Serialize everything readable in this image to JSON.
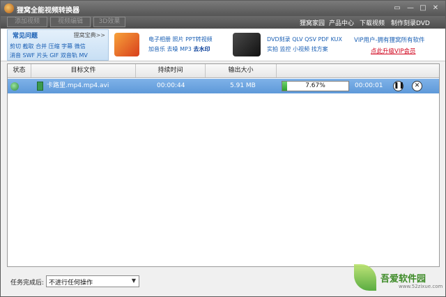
{
  "window": {
    "title": "狸窝全能视频转换器",
    "controls": {
      "restore": "▭",
      "minimize": "—",
      "maximize": "□",
      "close": "✕"
    }
  },
  "toolbar": {
    "buttons": [
      "添加视频",
      "视频编辑",
      "3D效果"
    ],
    "nav": [
      "狸窝家园",
      "产品中心",
      "下载视频",
      "制作刻录DVD"
    ]
  },
  "banner": {
    "faq": {
      "title": "常见问题",
      "link": "狸窝宝典>>",
      "line1": "剪切 截取 合并 压缩 字幕 微信",
      "line2": "消音 SWF 片头 GIF 双音轨 MV"
    },
    "promo1": {
      "line1": "电子相册 照片 PPT转视频",
      "line2_plain": "加音乐 去噪 MP3",
      "line2_bold": "去水印"
    },
    "promo2": {
      "line1": "DVD刻录 QLV QSV PDF KUX",
      "line2": "实拍 监控 小视频 找方案"
    },
    "vip": {
      "title": "VIP用户-拥有狸窝所有软件",
      "link": "点此升级VIP会员"
    }
  },
  "table": {
    "headers": [
      "状态",
      "目标文件",
      "持续时间",
      "输出大小",
      ""
    ],
    "rows": [
      {
        "file": "卡路里.mp4.mp4.avi",
        "duration": "00:00:44",
        "size": "5.91 MB",
        "progress_label": "7.67%",
        "progress": 0.0767,
        "elapsed": "00:00:01",
        "pause": "❚❚",
        "cancel": "✕"
      }
    ]
  },
  "footer": {
    "label": "任务完成后:",
    "select_value": "不进行任何操作",
    "select_arrow": "▼"
  },
  "watermark": {
    "text": "吾爱软件园",
    "url": "www.52zixue.com"
  }
}
